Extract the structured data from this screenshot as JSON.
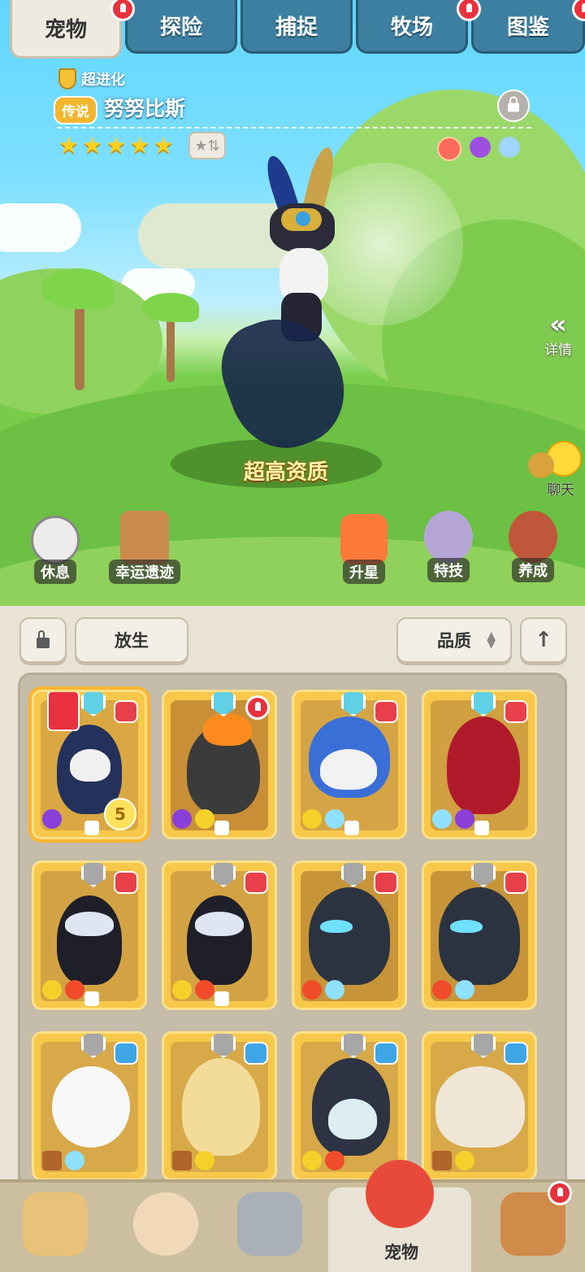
{
  "tabs": [
    {
      "label": "宠物",
      "active": true
    },
    {
      "label": "探险",
      "active": false
    },
    {
      "label": "捕捉",
      "active": false
    },
    {
      "label": "牧场",
      "active": false
    },
    {
      "label": "图鉴",
      "active": false
    }
  ],
  "pet": {
    "evolution_tag": "超进化",
    "rarity": "传说",
    "name": "努努比斯",
    "stars": 5,
    "quality_label": "超高资质"
  },
  "side": {
    "detail_label": "详情",
    "chat_label": "聊天"
  },
  "actions": {
    "rest": "休息",
    "relic": "幸运遗迹",
    "star_up": "升星",
    "skill": "特技",
    "train": "养成"
  },
  "toolbar": {
    "release": "放生",
    "sort": "品质"
  },
  "cards": [
    {
      "level": "5"
    }
  ],
  "nav": {
    "active_label": "宠物"
  },
  "colors": {
    "tab_blue": "#3d7fa0",
    "card_gold": "#f7c84a",
    "alert_red": "#e8313d",
    "panel_beige": "#e9e3d6"
  }
}
